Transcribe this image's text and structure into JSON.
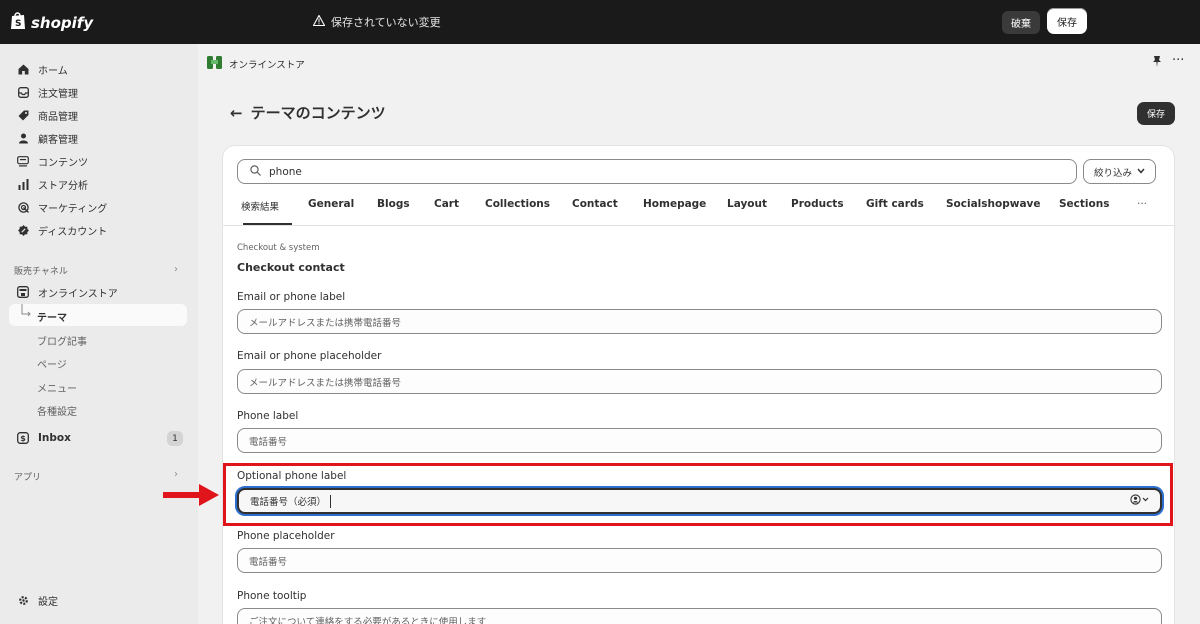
{
  "topbar": {
    "brand": "shopify",
    "unsaved_text": "保存されていない変更",
    "discard_label": "破棄",
    "save_label": "保存"
  },
  "sidebar": {
    "items": [
      {
        "label": "ホーム",
        "icon": "home-icon"
      },
      {
        "label": "注文管理",
        "icon": "inbox-tray-icon"
      },
      {
        "label": "商品管理",
        "icon": "tag-icon"
      },
      {
        "label": "顧客管理",
        "icon": "person-icon"
      },
      {
        "label": "コンテンツ",
        "icon": "content-icon"
      },
      {
        "label": "ストア分析",
        "icon": "bar-chart-icon"
      },
      {
        "label": "マーケティング",
        "icon": "target-icon"
      },
      {
        "label": "ディスカウント",
        "icon": "discount-icon"
      }
    ],
    "sales_channels_label": "販売チャネル",
    "online_store_label": "オンラインストア",
    "theme_label": "テーマ",
    "sub_items": [
      "ブログ記事",
      "ページ",
      "メニュー",
      "各種設定"
    ],
    "inbox_label": "Inbox",
    "inbox_count": "1",
    "apps_label": "アプリ",
    "settings_label": "設定"
  },
  "header": {
    "store_label": "オンラインストア"
  },
  "page": {
    "title": "テーマのコンテンツ",
    "save_label": "保存"
  },
  "search": {
    "value": "phone",
    "filter_label": "絞り込み"
  },
  "tabs": [
    "検索結果",
    "General",
    "Blogs",
    "Cart",
    "Collections",
    "Contact",
    "Homepage",
    "Layout",
    "Products",
    "Gift cards",
    "Socialshopwave",
    "Sections",
    "···"
  ],
  "section": {
    "breadcrumb": "Checkout & system",
    "title": "Checkout contact"
  },
  "fields": [
    {
      "label": "Email or phone label",
      "value": "メールアドレスまたは携帯電話番号"
    },
    {
      "label": "Email or phone placeholder",
      "value": "メールアドレスまたは携帯電話番号"
    },
    {
      "label": "Phone label",
      "value": "電話番号"
    },
    {
      "label": "Optional phone label",
      "value": "電話番号（必須）"
    },
    {
      "label": "Phone placeholder",
      "value": "電話番号"
    },
    {
      "label": "Phone tooltip",
      "value": "ご注文について連絡をする必要があるときに使用します"
    }
  ],
  "colors": {
    "highlight": "#e0141b",
    "topbar": "#1a1a1a",
    "focus_ring": "#2c6ecb"
  }
}
